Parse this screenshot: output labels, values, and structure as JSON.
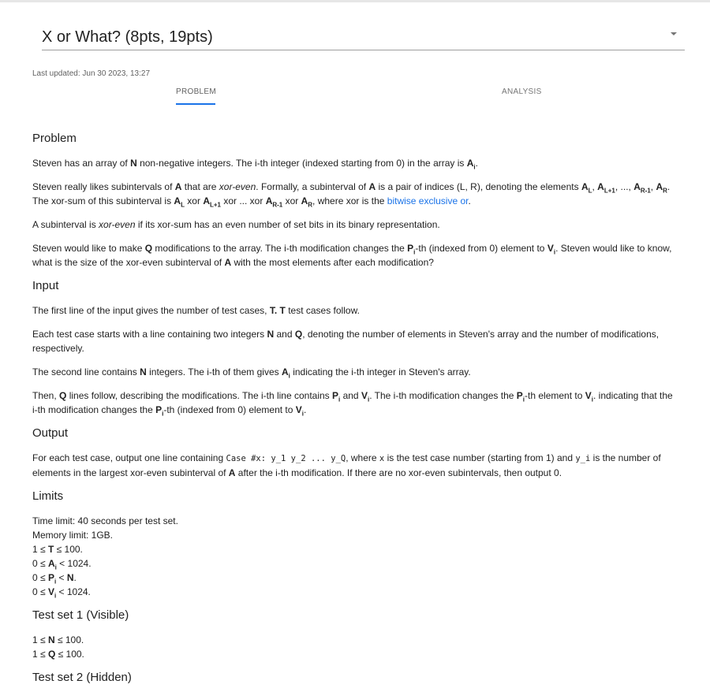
{
  "header": {
    "title": "X or What? (8pts, 19pts)",
    "last_updated": "Last updated: Jun 30 2023, 13:27"
  },
  "tabs": {
    "problem": "PROBLEM",
    "analysis": "ANALYSIS"
  },
  "problem": {
    "heading": "Problem",
    "p1_prefix": "Steven has an array of ",
    "p1_mid": " non-negative integers. The i-th integer (indexed starting from 0) in the array is ",
    "p2_prefix": "Steven really likes subintervals of ",
    "p2_xoreven": "xor-even",
    "p2_mid": ". Formally, a subinterval of ",
    "p2_mid2": " is a pair of indices (L, R), denoting the elements ",
    "p2_line2_a": "The xor-sum of this subinterval is ",
    "p2_line2_b": ", where xor is the ",
    "link_text": "bitwise exclusive or",
    "p3_prefix": "A subinterval is ",
    "p3_suffix": " if its xor-sum has an even number of set bits in its binary representation.",
    "p4_a": "Steven would like to make ",
    "p4_b": " modifications to the array. The i-th modification changes the ",
    "p4_c": "-th (indexed from 0) element to ",
    "p4_d": ". Steven would like to know,",
    "p4_e": "what is the size of the xor-even subinterval of ",
    "p4_f": " with the most elements after each modification?"
  },
  "input": {
    "heading": "Input",
    "p1_a": "The first line of the input gives the number of test cases, ",
    "p1_b": " test cases follow.",
    "p2_a": "Each test case starts with a line containing two integers ",
    "p2_b": " and ",
    "p2_c": ", denoting the number of elements in Steven's array and the number of modifications,",
    "p2_d": "respectively.",
    "p3_a": "The second line contains ",
    "p3_b": " integers. The i-th of them gives ",
    "p3_c": " indicating the i-th integer in Steven's array.",
    "p4_a": "Then, ",
    "p4_b": " lines follow, describing the modifications. The i-th line contains ",
    "p4_c": " and ",
    "p4_d": ". The i-th modification changes the ",
    "p4_e": "-th element to ",
    "p4_f": ". indicating that the",
    "p4_g": "i-th modification changes the ",
    "p4_h": "-th (indexed from 0) element to "
  },
  "output": {
    "heading": "Output",
    "p1_a": "For each test case, output one line containing ",
    "code1": "Case #x: y_1 y_2 ... y_Q",
    "p1_b": ", where ",
    "code2": "x",
    "p1_c": " is the test case number (starting from 1) and ",
    "code3": "y_i",
    "p1_d": " is the number of",
    "p1_e": "elements in the largest xor-even subinterval of ",
    "p1_f": " after the i-th modification. If there are no xor-even subintervals, then output 0."
  },
  "limits": {
    "heading": "Limits",
    "time": "Time limit: 40 seconds per test set.",
    "memory": "Memory limit: 1GB.",
    "c1_a": "1 ≤ ",
    "c1_b": " ≤ 100.",
    "c2_a": "0 ≤ ",
    "c2_b": " < 1024.",
    "c3_a": "0 ≤ ",
    "c3_b": " < ",
    "c4_a": "0 ≤ ",
    "c4_b": " < 1024."
  },
  "test_set_1": {
    "heading": "Test set 1 (Visible)",
    "c1_a": "1 ≤ ",
    "c1_b": " ≤ 100.",
    "c2_a": "1 ≤ ",
    "c2_b": " ≤ 100."
  },
  "test_set_2": {
    "heading": "Test set 2 (Hidden)"
  },
  "vars": {
    "N": "N",
    "A": "A",
    "Q": "Q",
    "T": "T",
    "P": "P",
    "V": "V",
    "i": "i",
    "L": "L",
    "L1": "L+1",
    "R1": "R-1",
    "R": "R",
    "seq_sep": ", ",
    "ellipsis": ", ..., ",
    "xor": " xor ",
    "xor_dots": " xor ... xor ",
    "period": ".",
    "comma": ",",
    "T_dot": "T."
  }
}
